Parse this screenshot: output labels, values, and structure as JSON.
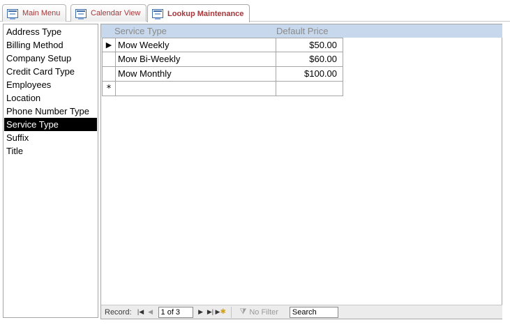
{
  "tabs": [
    {
      "label": "Main Menu",
      "icon": "form-icon",
      "active": false
    },
    {
      "label": "Calendar View",
      "icon": "form-icon",
      "active": false
    },
    {
      "label": "Lookup Maintenance",
      "icon": "form-icon",
      "active": true
    }
  ],
  "lookup_list": {
    "items": [
      {
        "label": "Address Type"
      },
      {
        "label": "Billing Method"
      },
      {
        "label": "Company Setup"
      },
      {
        "label": "Credit Card Type"
      },
      {
        "label": "Employees"
      },
      {
        "label": "Location"
      },
      {
        "label": "Phone Number Type"
      },
      {
        "label": "Service Type"
      },
      {
        "label": "Suffix"
      },
      {
        "label": "Title"
      }
    ],
    "selected": "Service Type"
  },
  "datasheet": {
    "columns": {
      "name": "Service Type",
      "price": "Default Price"
    },
    "rows": [
      {
        "name": "Mow Weekly",
        "price": "$50.00",
        "current": true
      },
      {
        "name": "Mow Bi-Weekly",
        "price": "$60.00",
        "current": false
      },
      {
        "name": "Mow Monthly",
        "price": "$100.00",
        "current": false
      }
    ],
    "new_row_marker": "*",
    "current_row_marker": "▶"
  },
  "navigation": {
    "record_label": "Record:",
    "record_position": "1 of 3",
    "filter_label": "No Filter",
    "search_value": "Search",
    "icons": {
      "first": "first-record-icon",
      "prev": "previous-record-icon",
      "next": "next-record-icon",
      "last": "last-record-icon",
      "new": "new-record-icon",
      "filter": "filter-off-icon"
    }
  },
  "colors": {
    "tab_text": "#a4373a",
    "header_band": "#c7d8ec",
    "selection": "#000000"
  }
}
